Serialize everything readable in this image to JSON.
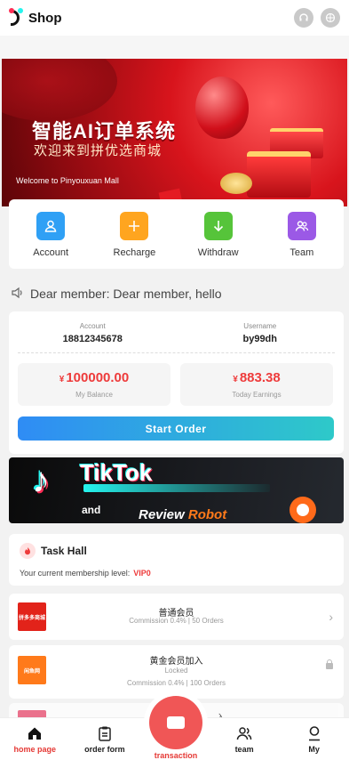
{
  "header": {
    "brand": "Shop",
    "support_icon": "headset-icon",
    "language_icon": "globe-icon"
  },
  "banner": {
    "title": "智能AI订单系统",
    "subtitle": "欢迎来到拼优选商城",
    "welcome": "Welcome to Pinyouxuan Mall"
  },
  "actions": [
    {
      "label": "Account",
      "icon": "user-icon",
      "color": "#2fa0f5"
    },
    {
      "label": "Recharge",
      "icon": "plus-icon",
      "color": "#ffa51f"
    },
    {
      "label": "Withdraw",
      "icon": "arrow-down-icon",
      "color": "#56c43a"
    },
    {
      "label": "Team",
      "icon": "team-icon",
      "color": "#9b59e6"
    }
  ],
  "notice": {
    "text": "Dear member: Dear member, hello"
  },
  "account": {
    "account_label": "Account",
    "account_value": "18812345678",
    "username_label": "Username",
    "username_value": "by99dh",
    "currency": "¥",
    "balance": "100000.00",
    "balance_label": "My Balance",
    "earnings": "883.38",
    "earnings_label": "Today Earnings",
    "start_label": "Start Order"
  },
  "promo": {
    "brand": "TikTok",
    "and": "and",
    "review": "Review",
    "robot": "Robot"
  },
  "task_hall": {
    "title": "Task Hall",
    "level_prefix": "Your current membership level:",
    "level": "VIP0"
  },
  "tiers": [
    {
      "thumb": "拼多多商城",
      "name": "普通会员",
      "status": "",
      "detail": "Commission 0.4% | 50 Orders",
      "color": "#e2231a",
      "locked": false
    },
    {
      "thumb": "闲鱼网",
      "name": "黄金会员加入",
      "status": "Locked",
      "detail": "Commission 0.4% | 100 Orders",
      "color": "#ff7a1a",
      "locked": true
    },
    {
      "thumb": "",
      "name": "入",
      "status": "",
      "detail": "",
      "color": "#e8476a",
      "locked": true
    }
  ],
  "nav": {
    "home": "home page",
    "order": "order form",
    "transaction": "transaction",
    "team": "team",
    "my": "My",
    "active_color": "#e53935"
  }
}
